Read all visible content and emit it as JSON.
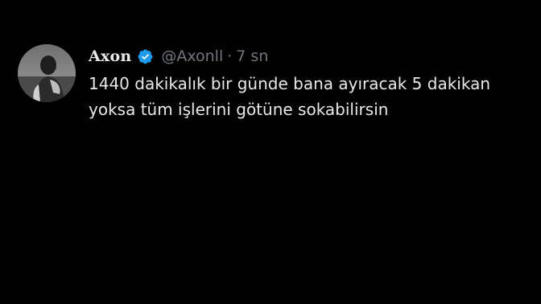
{
  "tweet": {
    "display_name": "Axon",
    "handle": "@Axonll",
    "separator": "·",
    "time": "7 sn",
    "text": "1440 dakikalık bir günde bana ayıracak 5 dakikan yoksa tüm işlerini götüne sokabilirsin",
    "verified_icon": "verified-badge-icon",
    "colors": {
      "background": "#000000",
      "primary_text": "#e7e9ea",
      "secondary_text": "#71767b",
      "verified_blue": "#1d9bf0"
    }
  }
}
